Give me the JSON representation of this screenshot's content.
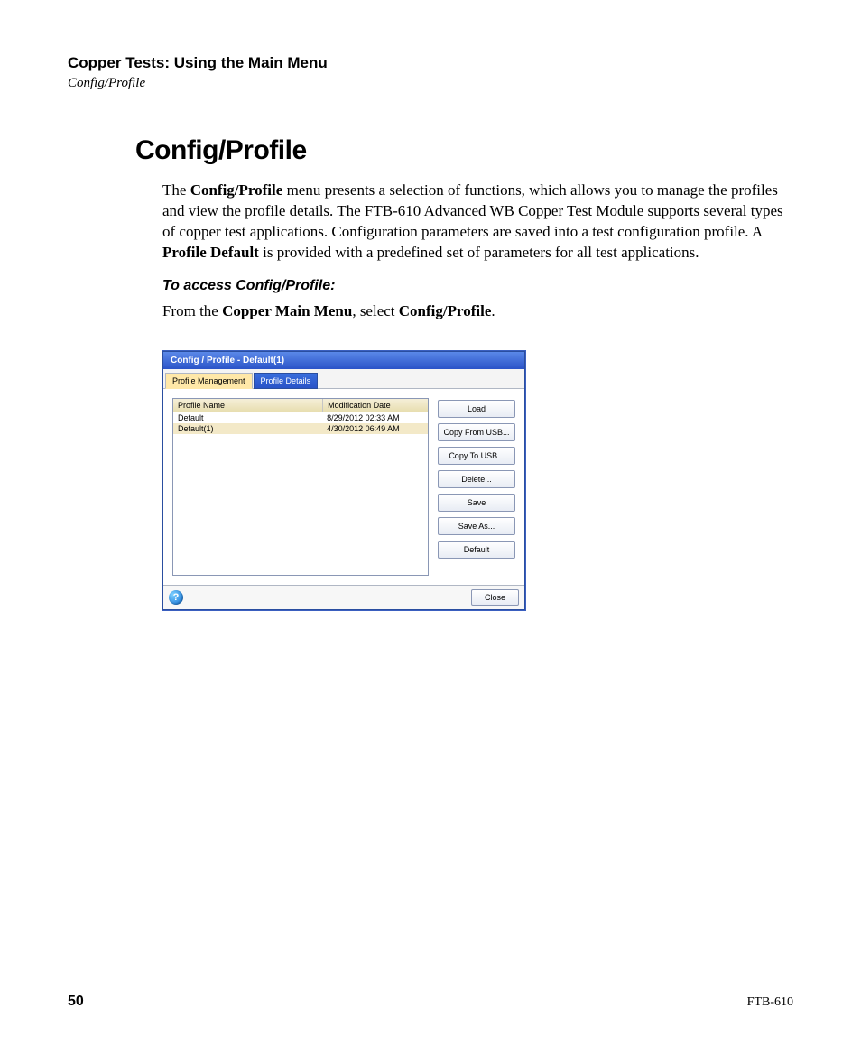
{
  "header": {
    "chapter": "Copper Tests: Using the Main Menu",
    "section": "Config/Profile"
  },
  "title": "Config/Profile",
  "paragraph1_parts": {
    "p1a": "The ",
    "p1b": "Config/Profile",
    "p1c": " menu presents a selection of functions, which allows you to manage the profiles and view the profile details. The FTB-610 Advanced WB Copper Test Module supports several types of copper test applications. Configuration parameters are saved into a test configuration profile. A ",
    "p1d": "Profile Default",
    "p1e": " is provided with a predefined set of parameters for all test applications."
  },
  "subheading": "To access Config/Profile:",
  "paragraph2_parts": {
    "p2a": "From the ",
    "p2b": "Copper Main Menu",
    "p2c": ", select ",
    "p2d": "Config/Profile",
    "p2e": "."
  },
  "window": {
    "title": "Config / Profile - Default(1)",
    "tabs": {
      "active": "Profile Management",
      "inactive": "Profile Details"
    },
    "columns": {
      "c1": "Profile Name",
      "c2": "Modification Date"
    },
    "rows": [
      {
        "name": "Default",
        "date": "8/29/2012 02:33 AM"
      },
      {
        "name": "Default(1)",
        "date": "4/30/2012 06:49 AM"
      }
    ],
    "buttons": {
      "load": "Load",
      "copyfrom": "Copy From USB...",
      "copyto": "Copy To USB...",
      "delete": "Delete...",
      "save": "Save",
      "saveas": "Save As...",
      "default": "Default"
    },
    "help": "?",
    "close": "Close"
  },
  "footer": {
    "page": "50",
    "product": "FTB-610"
  }
}
